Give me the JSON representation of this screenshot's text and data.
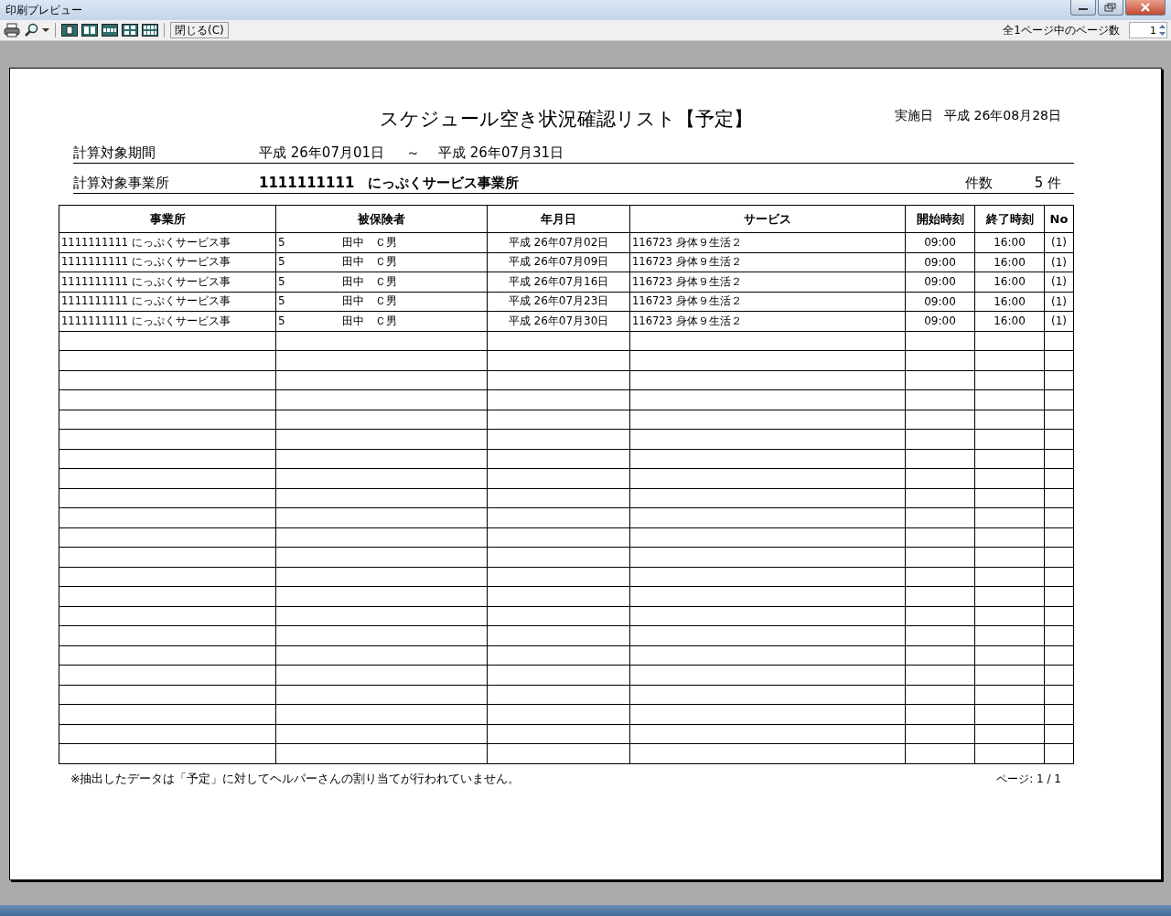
{
  "window": {
    "title": "印刷プレビュー"
  },
  "toolbar": {
    "close_button": "閉じる(C)",
    "page_count_label": "全1ページ中のページ数",
    "page_number": "1"
  },
  "report": {
    "title": "スケジュール空き状況確認リスト【予定】",
    "date_label": "実施日",
    "date": "平成 26年08月28日",
    "period": {
      "label": "計算対象期間",
      "from": "平成 26年07月01日",
      "separator": "～",
      "to": "平成 26年07月31日"
    },
    "office": {
      "label": "計算対象事業所",
      "value": "1111111111　にっぷくサービス事業所",
      "count_label": "件数",
      "count": "5 件"
    },
    "table": {
      "columns": [
        "事業所",
        "被保険者",
        "年月日",
        "サービス",
        "開始時刻",
        "終了時刻",
        "No"
      ],
      "rows": [
        {
          "office": "1111111111 にっぷくサービス事",
          "insured_no": "5",
          "insured_name": "田中　Ｃ男",
          "date": "平成 26年07月02日",
          "service": "116723 身体９生活２",
          "start": "09:00",
          "end": "16:00",
          "no": "(1)"
        },
        {
          "office": "1111111111 にっぷくサービス事",
          "insured_no": "5",
          "insured_name": "田中　Ｃ男",
          "date": "平成 26年07月09日",
          "service": "116723 身体９生活２",
          "start": "09:00",
          "end": "16:00",
          "no": "(1)"
        },
        {
          "office": "1111111111 にっぷくサービス事",
          "insured_no": "5",
          "insured_name": "田中　Ｃ男",
          "date": "平成 26年07月16日",
          "service": "116723 身体９生活２",
          "start": "09:00",
          "end": "16:00",
          "no": "(1)"
        },
        {
          "office": "1111111111 にっぷくサービス事",
          "insured_no": "5",
          "insured_name": "田中　Ｃ男",
          "date": "平成 26年07月23日",
          "service": "116723 身体９生活２",
          "start": "09:00",
          "end": "16:00",
          "no": "(1)"
        },
        {
          "office": "1111111111 にっぷくサービス事",
          "insured_no": "5",
          "insured_name": "田中　Ｃ男",
          "date": "平成 26年07月30日",
          "service": "116723 身体９生活２",
          "start": "09:00",
          "end": "16:00",
          "no": "(1)"
        }
      ]
    },
    "note": "※抽出したデータは「予定」に対してヘルパーさんの割り当てが行われていません。",
    "page": "ページ: 1 / 1"
  }
}
